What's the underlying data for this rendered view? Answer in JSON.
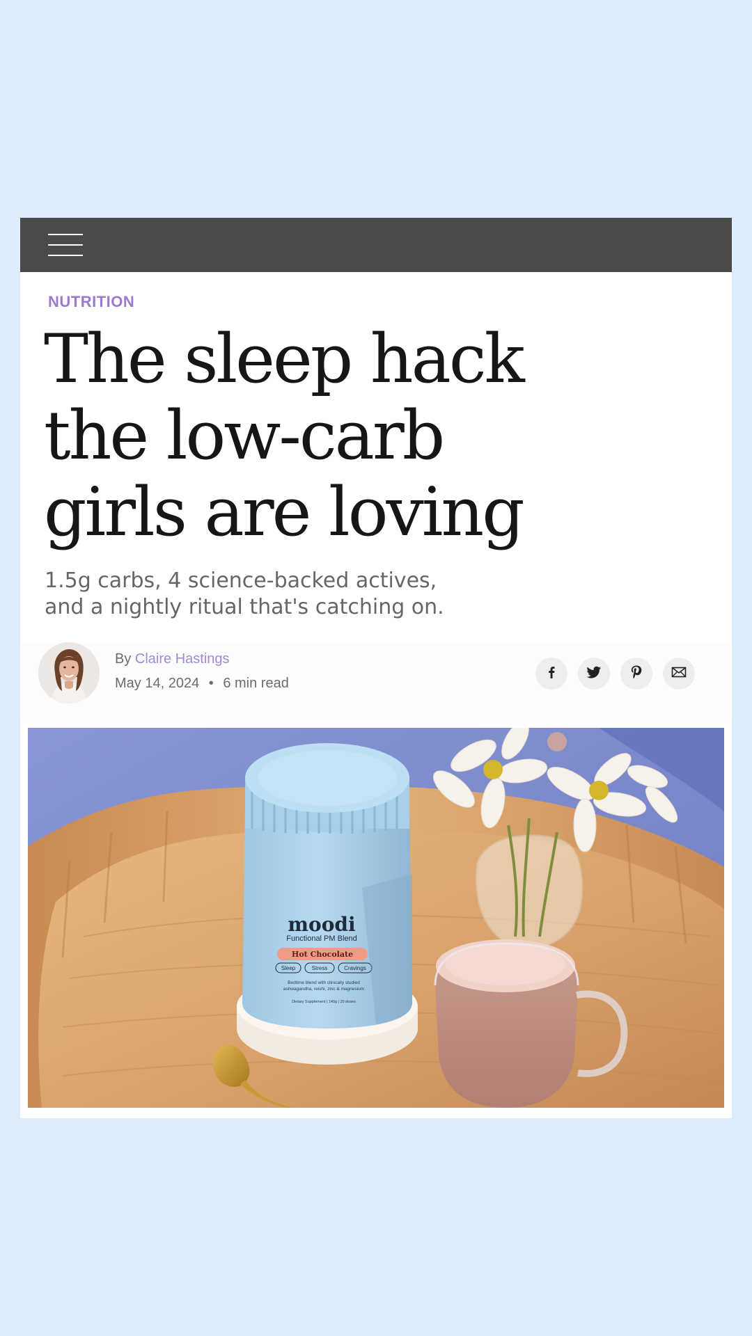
{
  "nav": {
    "menu_icon": "hamburger-menu-icon"
  },
  "article": {
    "category": "NUTRITION",
    "title_lines": [
      "The sleep hack",
      "the low-carb",
      "girls are loving"
    ],
    "dek_lines": [
      "1.5g carbs, 4 science-backed actives,",
      "and a nightly ritual that's catching on."
    ],
    "byline_prefix": "By",
    "author": "Claire Hastings",
    "date": "May 14, 2024",
    "separator": "•",
    "read_time": "6 min read"
  },
  "share": [
    {
      "icon": "facebook-icon"
    },
    {
      "icon": "twitter-icon"
    },
    {
      "icon": "pinterest-icon"
    },
    {
      "icon": "email-icon"
    }
  ],
  "hero_image": {
    "product": {
      "brand": "moodi",
      "subtitle": "Functional PM Blend",
      "flavor": "Hot Chocolate",
      "tags": [
        "Sleep",
        "Stress",
        "Cravings"
      ],
      "description_lines": [
        "Bedtime blend with clinically studied",
        "ashwagandha, reishi, zinc & magnesium"
      ],
      "footer": "Dietary Supplement  |  140g  |  20 doses"
    }
  },
  "colors": {
    "background": "#deedfd",
    "topbar": "#4a4a4a",
    "accent": "#9a7ad0",
    "headline": "#161616",
    "body_text": "#666666"
  }
}
